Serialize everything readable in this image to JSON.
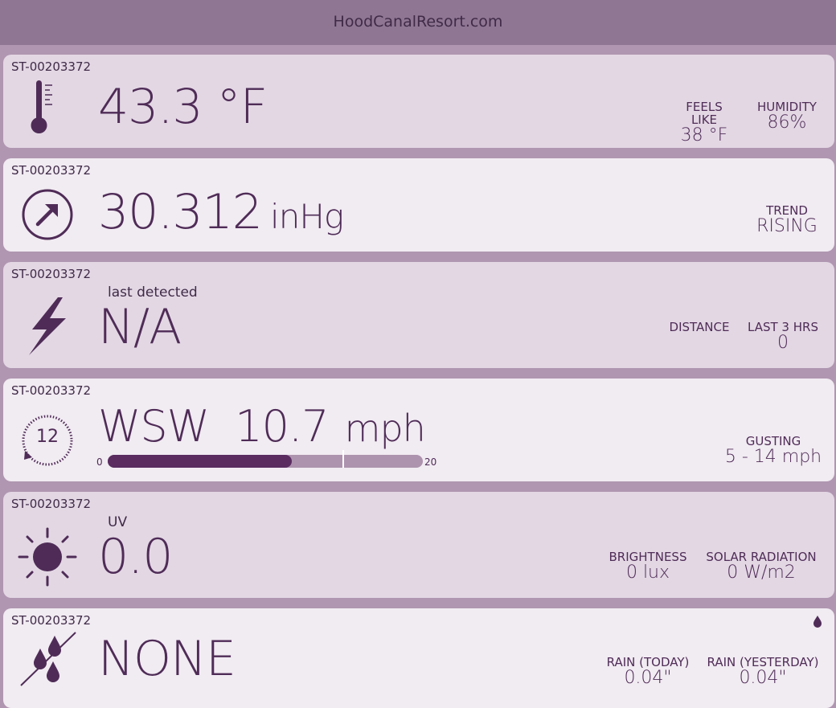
{
  "header": {
    "title": "HoodCanalResort.com"
  },
  "colors": {
    "primary": "#4f2c57",
    "background": "#b096b1",
    "header": "#8f7794",
    "card": "#e3d7e4",
    "card_alt": "#f1ebf2"
  },
  "temperature": {
    "station": "ST-00203372",
    "icon": "thermometer-icon",
    "value": "43.3 °F",
    "feels_like": {
      "label": "FEELS LIKE",
      "value": "38 °F"
    },
    "humidity": {
      "label": "HUMIDITY",
      "value": "86%"
    }
  },
  "pressure": {
    "station": "ST-00203372",
    "icon": "trend-up-arrow-icon",
    "value": "30.312",
    "unit": "inHg",
    "trend": {
      "label": "TREND",
      "value": "RISING"
    }
  },
  "lightning": {
    "station": "ST-00203372",
    "icon": "lightning-bolt-icon",
    "sublabel": "last detected",
    "value": "N/A",
    "distance": {
      "label": "DISTANCE",
      "value": ""
    },
    "last_3_hrs": {
      "label": "LAST 3 HRS",
      "value": "0"
    }
  },
  "wind": {
    "station": "ST-00203372",
    "icon": "wind-compass-icon",
    "compass_value": "12",
    "direction": "WSW",
    "speed": "10.7",
    "unit": "mph",
    "scale_min": "0",
    "scale_max": "20",
    "fill_fraction": 0.585,
    "marker_fraction": 0.745,
    "gusting": {
      "label": "GUSTING",
      "value": "5 - 14 mph"
    }
  },
  "uv": {
    "station": "ST-00203372",
    "icon": "sun-icon",
    "sublabel": "UV",
    "value": "0.0",
    "brightness": {
      "label": "BRIGHTNESS",
      "value": "0 lux"
    },
    "solar_radiation": {
      "label": "SOLAR RADIATION",
      "value": "0 W/m2"
    }
  },
  "rain": {
    "station": "ST-00203372",
    "icon": "no-rain-drops-icon",
    "corner_icon": "droplet-icon",
    "value": "NONE",
    "today": {
      "label": "RAIN (TODAY)",
      "value": "0.04\""
    },
    "yesterday": {
      "label": "RAIN (YESTERDAY)",
      "value": "0.04\""
    }
  }
}
